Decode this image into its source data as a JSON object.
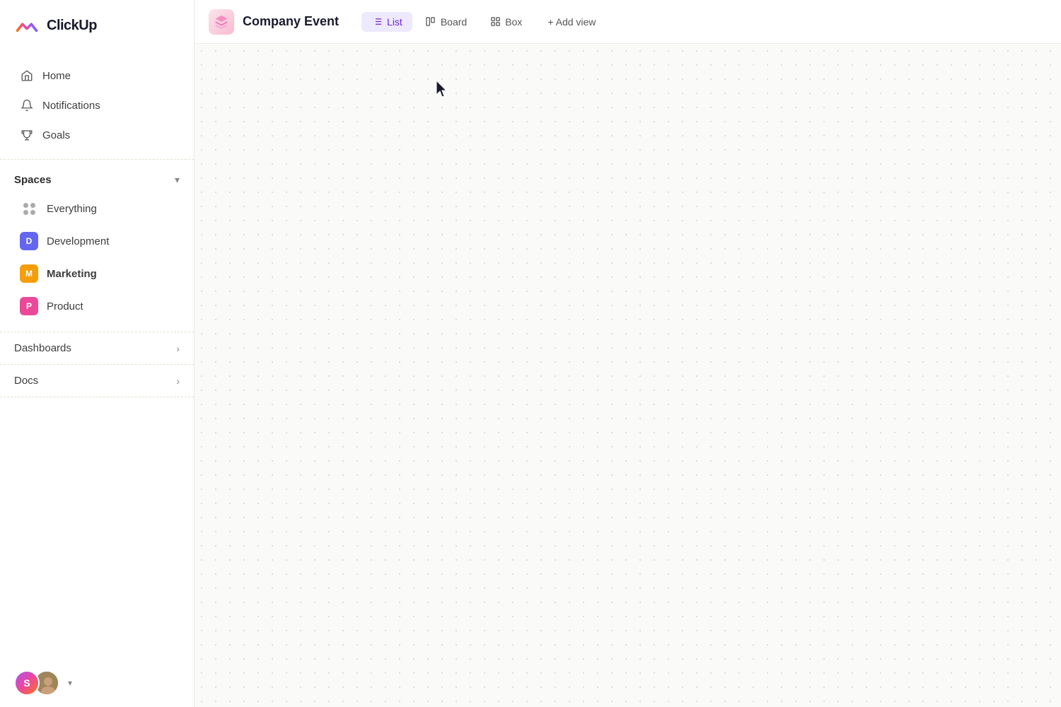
{
  "app": {
    "name": "ClickUp"
  },
  "sidebar": {
    "nav_items": [
      {
        "id": "home",
        "label": "Home",
        "icon": "home-icon"
      },
      {
        "id": "notifications",
        "label": "Notifications",
        "icon": "bell-icon"
      },
      {
        "id": "goals",
        "label": "Goals",
        "icon": "trophy-icon"
      }
    ],
    "spaces": {
      "title": "Spaces",
      "items": [
        {
          "id": "everything",
          "label": "Everything",
          "type": "everything"
        },
        {
          "id": "development",
          "label": "Development",
          "type": "space",
          "color": "#6366f1",
          "initial": "D"
        },
        {
          "id": "marketing",
          "label": "Marketing",
          "type": "space",
          "color": "#f59e0b",
          "initial": "M",
          "bold": true
        },
        {
          "id": "product",
          "label": "Product",
          "type": "space",
          "color": "#ec4899",
          "initial": "P"
        }
      ]
    },
    "dashboards": {
      "label": "Dashboards"
    },
    "docs": {
      "label": "Docs"
    },
    "footer": {
      "avatar1_initial": "S",
      "chevron": "▾"
    }
  },
  "topbar": {
    "project_title": "Company Event",
    "tabs": [
      {
        "id": "list",
        "label": "List",
        "active": true
      },
      {
        "id": "board",
        "label": "Board",
        "active": false
      },
      {
        "id": "box",
        "label": "Box",
        "active": false
      }
    ],
    "add_view_label": "+ Add view"
  }
}
